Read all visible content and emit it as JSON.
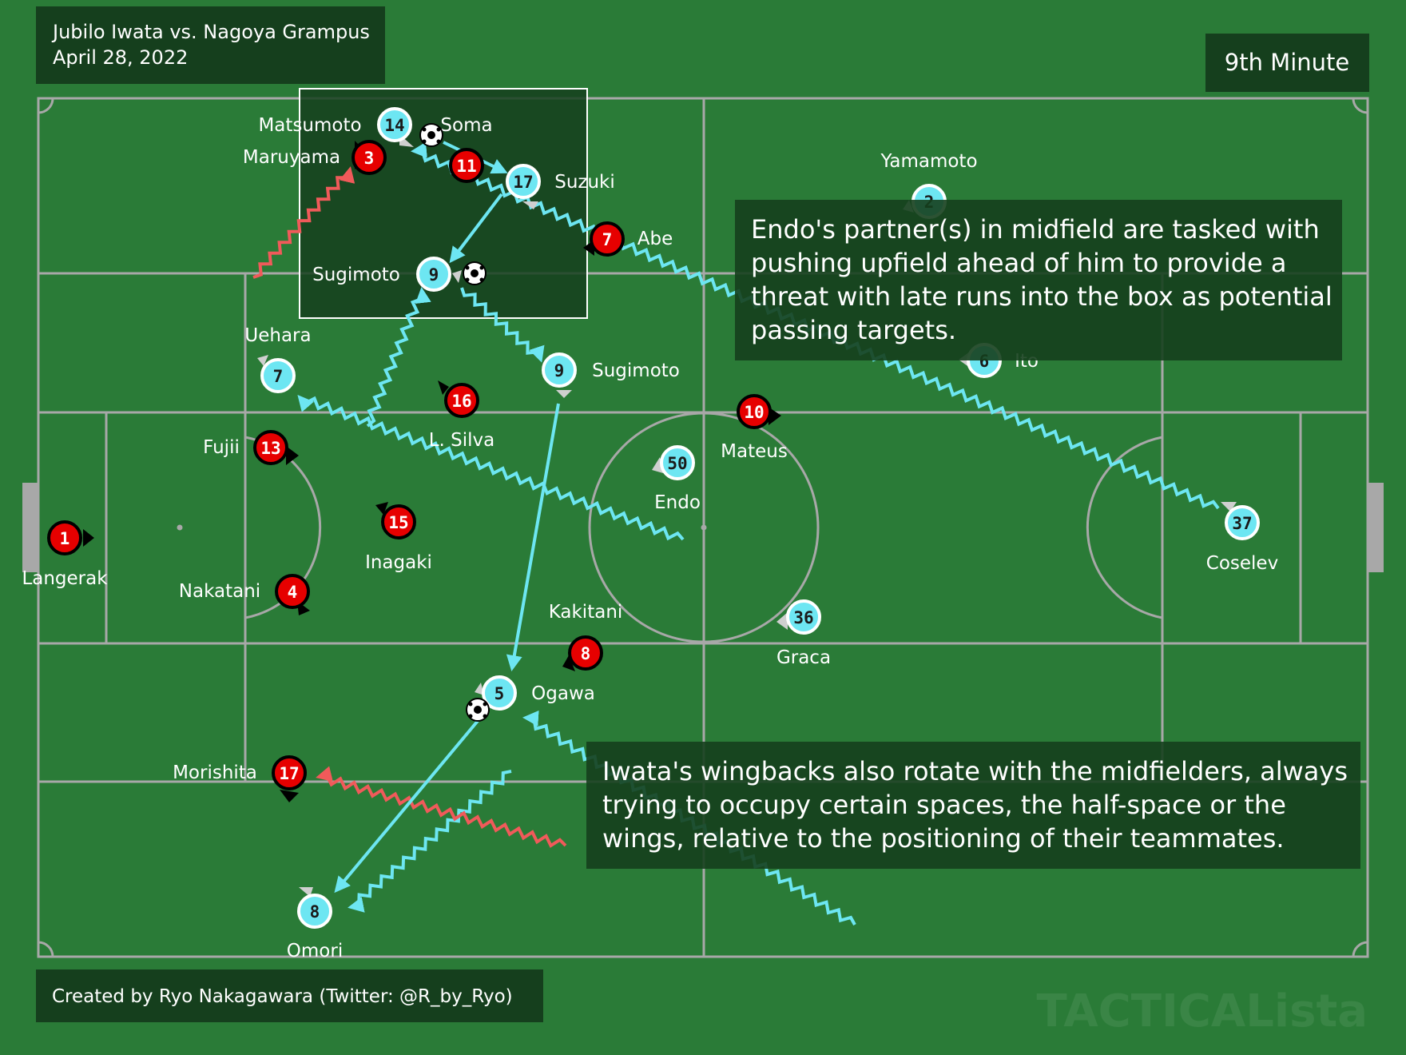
{
  "header": {
    "match": "Jubilo Iwata vs. Nagoya Grampus",
    "date": "April 28, 2022",
    "minute": "9th Minute"
  },
  "footer": {
    "credit": "Created by Ryo Nakagawara (Twitter: @R_by_Ryo)",
    "watermark": "TACTICALista"
  },
  "annotations": {
    "midfield": [
      "Endo's partner(s) in midfield are tasked with",
      "pushing upfield ahead of him to provide a",
      "threat with late runs into the box as potential",
      "passing targets."
    ],
    "wingbacks": [
      "Iwata's wingbacks also rotate with the midfielders, always",
      "trying to occupy certain spaces, the half-space or the",
      "wings, relative to the positioning of their teammates."
    ]
  },
  "colors": {
    "pitch": "#2a7b37",
    "lines": "#a8a8a8",
    "iwata": "#6de6f2",
    "nagoya": "#e60000",
    "nagoya_run": "#f05a5a",
    "panel": "#153f1d"
  },
  "players": {
    "iwata": [
      {
        "number": "14",
        "name": "Matsumoto"
      },
      {
        "number": "17",
        "name": "Suzuki"
      },
      {
        "number": "9",
        "name": "Sugimoto"
      },
      {
        "number": "9",
        "name": "Sugimoto"
      },
      {
        "number": "7",
        "name": "Uehara"
      },
      {
        "number": "2",
        "name": "Yamamoto"
      },
      {
        "number": "6",
        "name": "Ito"
      },
      {
        "number": "50",
        "name": "Endo"
      },
      {
        "number": "36",
        "name": "Graca"
      },
      {
        "number": "37",
        "name": "Coselev"
      },
      {
        "number": "5",
        "name": "Ogawa"
      },
      {
        "number": "8",
        "name": "Omori"
      }
    ],
    "nagoya": [
      {
        "number": "3",
        "name": "Maruyama"
      },
      {
        "number": "11",
        "name": "Soma"
      },
      {
        "number": "7",
        "name": "Abe"
      },
      {
        "number": "16",
        "name": "L. Silva"
      },
      {
        "number": "13",
        "name": "Fujii"
      },
      {
        "number": "15",
        "name": "Inagaki"
      },
      {
        "number": "1",
        "name": "Langerak"
      },
      {
        "number": "4",
        "name": "Nakatani"
      },
      {
        "number": "10",
        "name": "Mateus"
      },
      {
        "number": "8",
        "name": "Kakitani"
      },
      {
        "number": "17",
        "name": "Morishita"
      }
    ]
  }
}
